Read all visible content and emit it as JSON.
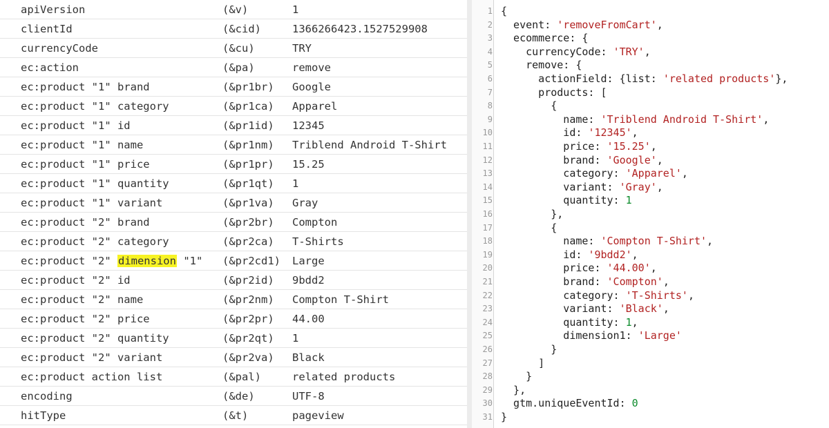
{
  "hit_params": [
    {
      "name": "apiVersion",
      "code": "(&v)",
      "value": "1"
    },
    {
      "name": "clientId",
      "code": "(&cid)",
      "value": "1366266423.1527529908"
    },
    {
      "name": "currencyCode",
      "code": "(&cu)",
      "value": "TRY"
    },
    {
      "name": "ec:action",
      "code": "(&pa)",
      "value": "remove"
    },
    {
      "name": "ec:product \"1\" brand",
      "code": "(&pr1br)",
      "value": "Google"
    },
    {
      "name": "ec:product \"1\" category",
      "code": "(&pr1ca)",
      "value": "Apparel"
    },
    {
      "name": "ec:product \"1\" id",
      "code": "(&pr1id)",
      "value": "12345"
    },
    {
      "name": "ec:product \"1\" name",
      "code": "(&pr1nm)",
      "value": "Triblend Android T-Shirt"
    },
    {
      "name": "ec:product \"1\" price",
      "code": "(&pr1pr)",
      "value": "15.25"
    },
    {
      "name": "ec:product \"1\" quantity",
      "code": "(&pr1qt)",
      "value": "1"
    },
    {
      "name": "ec:product \"1\" variant",
      "code": "(&pr1va)",
      "value": "Gray"
    },
    {
      "name": "ec:product \"2\" brand",
      "code": "(&pr2br)",
      "value": "Compton"
    },
    {
      "name": "ec:product \"2\" category",
      "code": "(&pr2ca)",
      "value": "T-Shirts"
    },
    {
      "name": "ec:product \"2\" dimension \"1\"",
      "name_pre": "ec:product \"2\" ",
      "name_hl": "dimension",
      "name_post": " \"1\"",
      "code": "(&pr2cd1)",
      "value": "Large"
    },
    {
      "name": "ec:product \"2\" id",
      "code": "(&pr2id)",
      "value": "9bdd2"
    },
    {
      "name": "ec:product \"2\" name",
      "code": "(&pr2nm)",
      "value": "Compton T-Shirt"
    },
    {
      "name": "ec:product \"2\" price",
      "code": "(&pr2pr)",
      "value": "44.00"
    },
    {
      "name": "ec:product \"2\" quantity",
      "code": "(&pr2qt)",
      "value": "1"
    },
    {
      "name": "ec:product \"2\" variant",
      "code": "(&pr2va)",
      "value": "Black"
    },
    {
      "name": "ec:product action list",
      "code": "(&pal)",
      "value": "related products"
    },
    {
      "name": "encoding",
      "code": "(&de)",
      "value": "UTF-8"
    },
    {
      "name": "hitType",
      "code": "(&t)",
      "value": "pageview"
    }
  ],
  "code_lines": [
    [
      {
        "t": "{"
      }
    ],
    [
      {
        "t": "  event: "
      },
      {
        "t": "'removeFromCart'",
        "c": "s"
      },
      {
        "t": ","
      }
    ],
    [
      {
        "t": "  ecommerce: {"
      }
    ],
    [
      {
        "t": "    currencyCode: "
      },
      {
        "t": "'TRY'",
        "c": "s"
      },
      {
        "t": ","
      }
    ],
    [
      {
        "t": "    remove: {"
      }
    ],
    [
      {
        "t": "      actionField: {list: "
      },
      {
        "t": "'related products'",
        "c": "s"
      },
      {
        "t": "},"
      }
    ],
    [
      {
        "t": "      products: ["
      }
    ],
    [
      {
        "t": "        {"
      }
    ],
    [
      {
        "t": "          name: "
      },
      {
        "t": "'Triblend Android T-Shirt'",
        "c": "s"
      },
      {
        "t": ","
      }
    ],
    [
      {
        "t": "          id: "
      },
      {
        "t": "'12345'",
        "c": "s"
      },
      {
        "t": ","
      }
    ],
    [
      {
        "t": "          price: "
      },
      {
        "t": "'15.25'",
        "c": "s"
      },
      {
        "t": ","
      }
    ],
    [
      {
        "t": "          brand: "
      },
      {
        "t": "'Google'",
        "c": "s"
      },
      {
        "t": ","
      }
    ],
    [
      {
        "t": "          category: "
      },
      {
        "t": "'Apparel'",
        "c": "s"
      },
      {
        "t": ","
      }
    ],
    [
      {
        "t": "          variant: "
      },
      {
        "t": "'Gray'",
        "c": "s"
      },
      {
        "t": ","
      }
    ],
    [
      {
        "t": "          quantity: "
      },
      {
        "t": "1",
        "c": "n"
      }
    ],
    [
      {
        "t": "        },"
      }
    ],
    [
      {
        "t": "        {"
      }
    ],
    [
      {
        "t": "          name: "
      },
      {
        "t": "'Compton T-Shirt'",
        "c": "s"
      },
      {
        "t": ","
      }
    ],
    [
      {
        "t": "          id: "
      },
      {
        "t": "'9bdd2'",
        "c": "s"
      },
      {
        "t": ","
      }
    ],
    [
      {
        "t": "          price: "
      },
      {
        "t": "'44.00'",
        "c": "s"
      },
      {
        "t": ","
      }
    ],
    [
      {
        "t": "          brand: "
      },
      {
        "t": "'Compton'",
        "c": "s"
      },
      {
        "t": ","
      }
    ],
    [
      {
        "t": "          category: "
      },
      {
        "t": "'T-Shirts'",
        "c": "s"
      },
      {
        "t": ","
      }
    ],
    [
      {
        "t": "          variant: "
      },
      {
        "t": "'Black'",
        "c": "s"
      },
      {
        "t": ","
      }
    ],
    [
      {
        "t": "          quantity: "
      },
      {
        "t": "1",
        "c": "n"
      },
      {
        "t": ","
      }
    ],
    [
      {
        "t": "          dimension1: "
      },
      {
        "t": "'Large'",
        "c": "s"
      }
    ],
    [
      {
        "t": "        }"
      }
    ],
    [
      {
        "t": "      ]"
      }
    ],
    [
      {
        "t": "    }"
      }
    ],
    [
      {
        "t": "  },"
      }
    ],
    [
      {
        "t": "  gtm.uniqueEventId: "
      },
      {
        "t": "0",
        "c": "n"
      }
    ],
    [
      {
        "t": "}"
      }
    ]
  ],
  "colors": {
    "string": "#b22222",
    "number": "#0a8a2a",
    "highlight": "#f7f324",
    "line_number": "#999999"
  }
}
